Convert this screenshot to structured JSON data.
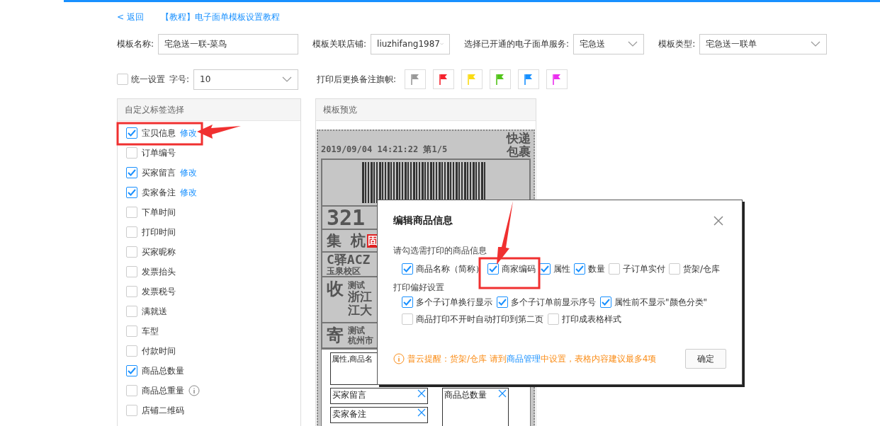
{
  "nav": {
    "back": "< 返回",
    "tutorial": "【教程】电子面单模板设置教程"
  },
  "form": [
    {
      "label": "模板名称:",
      "kind": "input",
      "value": "宅急送一联-菜鸟"
    },
    {
      "label": "模板关联店铺:",
      "kind": "select",
      "value": "liuzhifang1987"
    },
    {
      "label": "选择已开通的电子面单服务:",
      "kind": "select",
      "value": "宅急送"
    },
    {
      "label": "模板类型:",
      "kind": "select",
      "value": "宅急送一联单"
    }
  ],
  "options": {
    "unified": {
      "label": "统一设置",
      "checked": false
    },
    "font_size": {
      "label": "字号:",
      "value": "10"
    },
    "flags_label": "打印后更换备注旗帜:",
    "flags": [
      {
        "color": "#999999"
      },
      {
        "color": "#f5222d"
      },
      {
        "color": "#fadb14"
      },
      {
        "color": "#52c41a"
      },
      {
        "color": "#1890ff"
      },
      {
        "color": "#eb2fef"
      }
    ]
  },
  "tag_panel": {
    "title": "自定义标签选择",
    "items": [
      {
        "label": "宝贝信息",
        "checked": true,
        "edit": "修改"
      },
      {
        "label": "订单编号",
        "checked": false
      },
      {
        "label": "买家留言",
        "checked": true,
        "edit": "修改"
      },
      {
        "label": "卖家备注",
        "checked": true,
        "edit": "修改"
      },
      {
        "label": "下单时间",
        "checked": false
      },
      {
        "label": "打印时间",
        "checked": false
      },
      {
        "label": "买家昵称",
        "checked": false
      },
      {
        "label": "发票抬头",
        "checked": false
      },
      {
        "label": "发票税号",
        "checked": false
      },
      {
        "label": "满就送",
        "checked": false
      },
      {
        "label": "车型",
        "checked": false
      },
      {
        "label": "付款时间",
        "checked": false
      },
      {
        "label": "商品总数量",
        "checked": true
      },
      {
        "label": "商品总重量",
        "checked": false,
        "info": true
      },
      {
        "label": "店铺二维码",
        "checked": false
      }
    ]
  },
  "preview": {
    "title": "模板预览",
    "label": {
      "service": [
        "快递",
        "包裹"
      ],
      "timestamp": "2019/09/04 14:21:22 第1/5",
      "route_code": "321",
      "hub": "集 杭",
      "hub_tag": "固",
      "station": "C驿ACZ",
      "station_sub": "玉泉校区",
      "receiver": {
        "mark": "收",
        "lines": [
          "测试",
          "浙江",
          "江大"
        ]
      },
      "sender": {
        "mark": "寄",
        "lines": [
          "测试",
          "杭州市"
        ]
      },
      "goods": "属性,商品名",
      "fields": [
        {
          "text": "买家留言"
        },
        {
          "text": "卖家备注"
        }
      ],
      "side_field": {
        "text": "商品总数量"
      }
    }
  },
  "dialog": {
    "title": "编辑商品信息",
    "section_1": "请勾选需打印的商品信息",
    "items": [
      {
        "label": "商品名称（简称）",
        "checked": true
      },
      {
        "label": "商家编码",
        "checked": true
      },
      {
        "label": "属性",
        "checked": true
      },
      {
        "label": "数量",
        "checked": true
      },
      {
        "label": "子订单实付",
        "checked": false
      },
      {
        "label": "货架/仓库",
        "checked": false
      }
    ],
    "section_2": "打印偏好设置",
    "preference_rows": [
      {
        "items": [
          {
            "label": "多个子订单换行显示",
            "checked": true
          },
          {
            "label": "多个子订单前显示序号",
            "checked": true
          },
          {
            "label": "属性前不显示\"颜色分类\"",
            "checked": true
          }
        ]
      },
      {
        "items": [
          {
            "label": "商品打印不开时自动打印到第二页",
            "checked": false
          },
          {
            "label": "打印成表格样式",
            "checked": false
          }
        ]
      }
    ],
    "notice": {
      "prefix": "普云提醒：货架/仓库 请到",
      "link": "商品管理",
      "suffix": "中设置，表格内容建议最多4项"
    },
    "confirm": "确定"
  }
}
